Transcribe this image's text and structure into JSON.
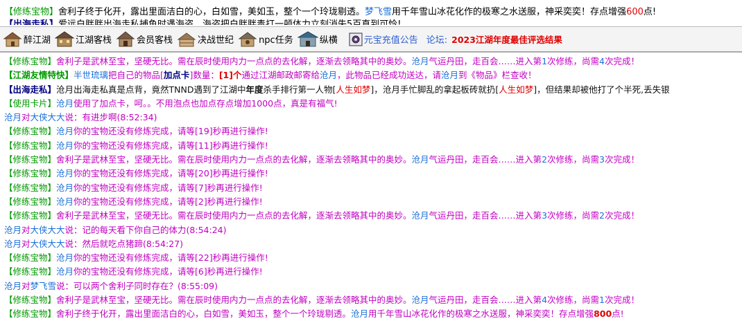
{
  "ticker": {
    "line1": {
      "tag": "【修练宝物】",
      "text_a": "舍利子终于化开，露出里面洁白的心，白如雪，美如玉，整个一个玲珑剔透。",
      "name": "梦飞雪",
      "text_b": "用千年雪山冰花化作的极寒之水送服，神采奕奕！存点增强",
      "num": "600",
      "text_c": "点!"
    },
    "line2": {
      "tag": "【出海走私】",
      "text": "爱远白胖胖出海走私捕鱼时遇海盗，海盗把白胖胖毒打一顿体力立刻消失5百直到可怜!"
    }
  },
  "nav": {
    "items": [
      {
        "label": "醉江湖",
        "icon": "tavern-house-icon"
      },
      {
        "label": "江湖客栈",
        "icon": "inn-house-icon"
      },
      {
        "label": "会员客栈",
        "icon": "member-inn-icon"
      },
      {
        "label": "决战世纪",
        "icon": "battle-house-icon"
      },
      {
        "label": "npc任务",
        "icon": "npc-quest-icon"
      },
      {
        "label": "纵横",
        "icon": "palace-icon"
      }
    ],
    "recharge_label": "元宝充值公告",
    "forum_label": "论坛:",
    "forum_link": "2023江湖年度最佳评选结果"
  },
  "chat": {
    "tag_treasure": "【修练宝物】",
    "tag_friend": "【江湖友情特快】",
    "tag_smuggle": "【出海走私】",
    "tag_card": "【使用卡片】",
    "sarira_text": "舍利子是武林至宝，坚硬无比。需在辰时使用内力一点点的去化解，逐渐去领略其中的奥妙。",
    "sarira_player": "沧月",
    "sarira_mid": "气运丹田，走百会……进入第",
    "sarira_nums": [
      "1",
      "2",
      "3",
      "4"
    ],
    "sarira_remain": [
      "4",
      "3",
      "2",
      "1"
    ],
    "sarira_times": "次修练，尚需",
    "sarira_end": "次完成！",
    "wait_player": "沧月",
    "wait_pre": "你的宝物还没有修炼完成，请等[",
    "wait_post": "]秒再进行操作!",
    "wait_secs": [
      "19",
      "11",
      "20",
      "7",
      "2",
      "22",
      "6"
    ],
    "friend": {
      "sender": "半世琉璃",
      "t1": "把自己的物品[",
      "item": "加点卡",
      "t2": "]数量：",
      "qty": "[1]个",
      "t3": "通过江湖邮政邮寄给",
      "recv": "沧月",
      "t4": "，此物品已经成功送达，请",
      "recv2": "沧月",
      "t5": "到《物品》栏查收！"
    },
    "smuggle": {
      "p1": "沧月",
      "t1": "出海走私真是点背，竟然TNND遇到了江湖中",
      "t1b": "年度",
      "t1c": "杀手排行第一人物[",
      "killer": "人生如梦",
      "t2": "]，",
      "p2": "沧月",
      "t3": "手忙脚乱的拿起板砖就扔[",
      "killer2": "人生如梦",
      "t4": "]，但结果却被他打了个半死,丢失银"
    },
    "card": {
      "p": "沧月",
      "t": "使用了加点卡，呵。。不用泡点也加点存点增加1000点，真是有福气!"
    },
    "talk": [
      {
        "from": "沧月",
        "to": "大侠大大",
        "text": "说：有进步啊(8:52:34)"
      },
      {
        "from": "沧月",
        "to": "大侠大大",
        "text": "说：记的每天看下你自己的体力(8:54:24)"
      },
      {
        "from": "沧月",
        "to": "大侠大大",
        "text": "说：然后就吃点猪蹄(8:54:27)"
      },
      {
        "from": "沧月",
        "to": "梦飞雪",
        "text": "说：可以两个舍利子同时存在？(8:55:09)"
      }
    ],
    "to_word": "对",
    "final": {
      "text_a": "舍利子终于化开，露出里面洁白的心，白如雪，美如玉，整个一个玲珑剔透。",
      "name": "沧月",
      "text_b": "用千年雪山冰花化作的极寒之水送服，神采奕奕！存点增强",
      "num": "800",
      "text_c": "点!"
    }
  }
}
